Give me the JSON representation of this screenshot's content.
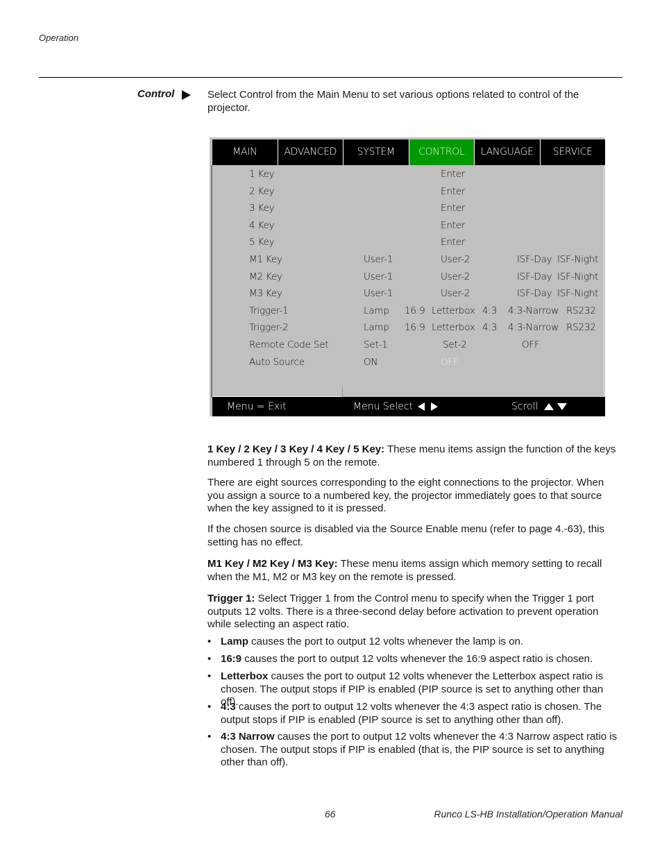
{
  "header": {
    "running_head": "Operation"
  },
  "section": {
    "label": "Control",
    "intro": "Select Control from the Main Menu to set various options related to control of the projector."
  },
  "osd_menu": {
    "tabs": [
      {
        "label": "MAIN",
        "active": false
      },
      {
        "label": "ADVANCED",
        "active": false
      },
      {
        "label": "SYSTEM",
        "active": false
      },
      {
        "label": "CONTROL",
        "active": true
      },
      {
        "label": "LANGUAGE",
        "active": false
      },
      {
        "label": "SERVICE",
        "active": false
      }
    ],
    "colors": {
      "tab_bar": "#000000",
      "active_tab": "#009a00",
      "body": "#c0c0c0",
      "footer": "#000000"
    },
    "rows": [
      {
        "label": "1 Key",
        "options": [
          "Enter"
        ]
      },
      {
        "label": "2 Key",
        "options": [
          "Enter"
        ]
      },
      {
        "label": "3 Key",
        "options": [
          "Enter"
        ]
      },
      {
        "label": "4 Key",
        "options": [
          "Enter"
        ]
      },
      {
        "label": "5 Key",
        "options": [
          "Enter"
        ]
      },
      {
        "label": "M1 Key",
        "options": [
          "User-1",
          "User-2",
          "ISF-Day",
          "ISF-Night"
        ]
      },
      {
        "label": "M2 Key",
        "options": [
          "User-1",
          "User-2",
          "ISF-Day",
          "ISF-Night"
        ]
      },
      {
        "label": "M3 Key",
        "options": [
          "User-1",
          "User-2",
          "ISF-Day",
          "ISF-Night"
        ]
      },
      {
        "label": "Trigger-1",
        "options": [
          "Lamp",
          "16:9",
          "Letterbox",
          "4:3",
          "4:3-Narrow",
          "RS232"
        ]
      },
      {
        "label": "Trigger-2",
        "options": [
          "Lamp",
          "16:9",
          "Letterbox",
          "4:3",
          "4:3-Narrow",
          "RS232"
        ]
      },
      {
        "label": "Remote Code Set",
        "options": [
          "Set-1",
          "Set-2",
          "OFF"
        ]
      },
      {
        "label": "Auto Source",
        "options": [
          "ON",
          "OFF"
        ],
        "dimmed_option_index": 1
      }
    ],
    "footer": {
      "exit": "Menu = Exit",
      "menu_select": "Menu Select",
      "scroll": "Scroll"
    }
  },
  "body": {
    "p1_bold": "1 Key / 2 Key / 3 Key / 4 Key / 5 Key:",
    "p1_text": " These menu items assign the function of the keys numbered 1 through 5 on the remote.",
    "p2": "There are eight sources corresponding to the eight connections to the projector. When you assign a source to a numbered key, the projector immediately goes to that source when the key assigned to it is pressed.",
    "p3": "If the chosen source is disabled via the Source Enable menu (refer to page 4.-63), this setting has no effect.",
    "p4_bold": "M1 Key / M2 Key / M3 Key:",
    "p4_text": " These menu items assign which memory setting to recall when the M1, M2 or M3 key on the remote is pressed.",
    "p5_bold": "Trigger 1:",
    "p5_text": " Select Trigger 1 from the Control menu to specify when the Trigger 1 port outputs 12 volts. There is a three-second delay before activation to prevent operation while selecting an aspect ratio.",
    "bullets": [
      {
        "bold": "Lamp",
        "text": " causes the port to output 12 volts whenever the lamp is on."
      },
      {
        "bold": "16:9",
        "text": " causes the port to output 12 volts whenever the 16:9 aspect ratio is chosen."
      },
      {
        "bold": "Letterbox",
        "text": " causes the port to output 12 volts whenever the Letterbox aspect ratio is chosen. The output stops if PIP is enabled (PIP source is set to anything other than off)."
      },
      {
        "bold": "4:3",
        "text": " causes the port to output 12 volts whenever the 4:3 aspect ratio is chosen. The output stops if PIP is enabled (PIP source is set to anything other than off)."
      },
      {
        "bold": "4:3 Narrow",
        "text": " causes the port to output 12 volts whenever the 4:3 Narrow aspect ratio is chosen.  The output stops if PIP is enabled (that is, the PIP source is set to anything other than off)."
      }
    ],
    "bullet_char": "•"
  },
  "footer": {
    "page_number": "66",
    "manual_title": "Runco LS-HB Installation/Operation Manual"
  }
}
